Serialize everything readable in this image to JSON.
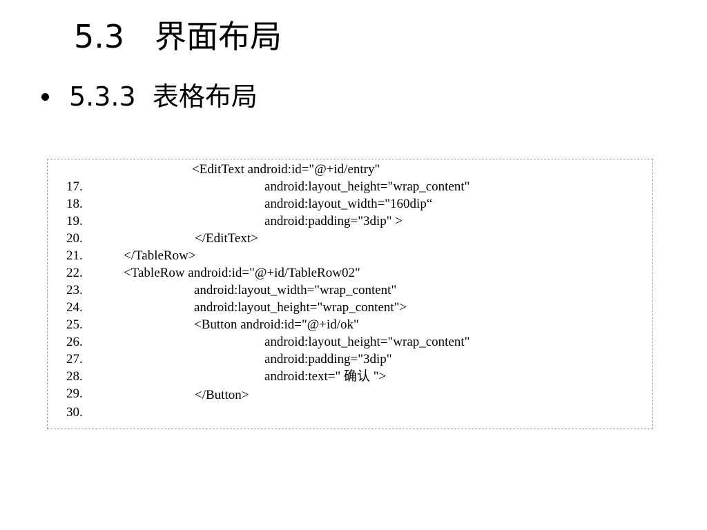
{
  "slide": {
    "title": "5.3   界面布局",
    "bullet": "5.3.3  表格布局"
  },
  "code": {
    "lines": [
      {
        "num": "17.",
        "text": "<EditText android:id=\"@+id/entry\""
      },
      {
        "num": "18.",
        "text": "android:layout_height=\"wrap_content\""
      },
      {
        "num": "19.",
        "text": "android:layout_width=\"160dip“"
      },
      {
        "num": "20.",
        "text": "android:padding=\"3dip\" >"
      },
      {
        "num": "21.",
        "text": "</EditText>"
      },
      {
        "num": "22.",
        "text": "</TableRow>"
      },
      {
        "num": "23.",
        "text": "<TableRow android:id=\"@+id/TableRow02\""
      },
      {
        "num": "24.",
        "text": "android:layout_width=\"wrap_content\""
      },
      {
        "num": "25.",
        "text": "android:layout_height=\"wrap_content\">"
      },
      {
        "num": "26.",
        "text": "<Button android:id=\"@+id/ok\""
      },
      {
        "num": "27.",
        "text": "android:layout_height=\"wrap_content\""
      },
      {
        "num": "28.",
        "text": "android:padding=\"3dip\""
      },
      {
        "num": "29.",
        "text": "android:text=\" 确认 \">"
      },
      {
        "num": "30.",
        "text": "</Button>"
      }
    ]
  }
}
